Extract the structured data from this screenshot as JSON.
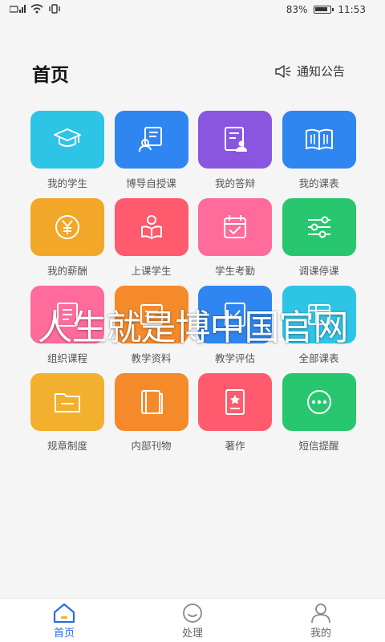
{
  "status_bar": {
    "battery": "83%",
    "time": "11:53"
  },
  "header": {
    "title": "首页",
    "notice_label": "通知公告"
  },
  "tiles": [
    {
      "label": "我的学生",
      "icon": "graduation-cap-icon",
      "color": "#2ec4e6"
    },
    {
      "label": "博导自授课",
      "icon": "teacher-board-icon",
      "color": "#2f86f0"
    },
    {
      "label": "我的答辩",
      "icon": "document-person-icon",
      "color": "#8a56e0"
    },
    {
      "label": "我的课表",
      "icon": "open-book-icon",
      "color": "#2f86f0"
    },
    {
      "label": "我的薪酬",
      "icon": "yen-coin-icon",
      "color": "#f2a728"
    },
    {
      "label": "上课学生",
      "icon": "student-reading-icon",
      "color": "#ff5a6e"
    },
    {
      "label": "学生考勤",
      "icon": "calendar-check-icon",
      "color": "#ff6b9a"
    },
    {
      "label": "调课停课",
      "icon": "sliders-icon",
      "color": "#28c76f"
    },
    {
      "label": "组织课程",
      "icon": "course-organize-icon",
      "color": "#ff6b9a"
    },
    {
      "label": "教学资料",
      "icon": "teaching-materials-icon",
      "color": "#f58a2a"
    },
    {
      "label": "教学评估",
      "icon": "evaluation-icon",
      "color": "#2f86f0"
    },
    {
      "label": "全部课表",
      "icon": "all-schedule-icon",
      "color": "#2ec4e6"
    },
    {
      "label": "规章制度",
      "icon": "folder-icon",
      "color": "#f2b02e"
    },
    {
      "label": "内部刊物",
      "icon": "books-icon",
      "color": "#f58a2a"
    },
    {
      "label": "著作",
      "icon": "certificate-icon",
      "color": "#ff5a6e"
    },
    {
      "label": "短信提醒",
      "icon": "chat-dots-icon",
      "color": "#28c76f"
    }
  ],
  "watermark": "人生就是博中国官网",
  "tabbar": {
    "items": [
      {
        "label": "首页",
        "icon": "home-icon",
        "active": true
      },
      {
        "label": "处理",
        "icon": "smile-icon",
        "active": false
      },
      {
        "label": "我的",
        "icon": "user-icon",
        "active": false
      }
    ]
  }
}
